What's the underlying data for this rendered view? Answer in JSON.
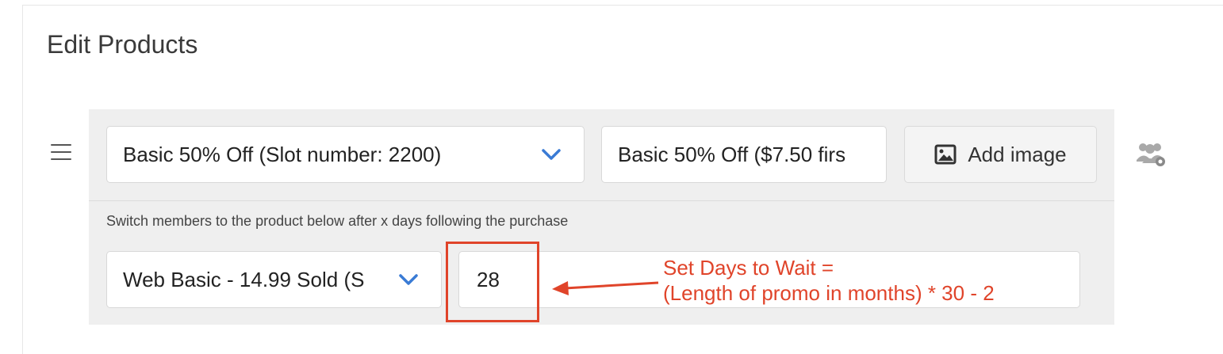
{
  "page": {
    "title": "Edit Products"
  },
  "product_row": {
    "product_select": {
      "value": "Basic 50% Off (Slot number: 2200)"
    },
    "product_name_field": {
      "value": "Basic 50% Off ($7.50 firs"
    },
    "add_image_button": {
      "label": "Add image",
      "icon": "image-icon"
    },
    "members_settings_icon": "members-settings-icon",
    "switch_label": "Switch members to the product below after x days following the purchase",
    "switch_target_select": {
      "value": "Web Basic - 14.99 Sold (S"
    },
    "days_to_wait_field": {
      "value": "28"
    }
  },
  "annotation": {
    "line1": "Set Days to Wait =",
    "line2": "(Length of promo in months) * 30 - 2",
    "color": "#e0442a"
  },
  "colors": {
    "accent_chevron": "#3a7bd5",
    "row_background": "#efefef"
  }
}
